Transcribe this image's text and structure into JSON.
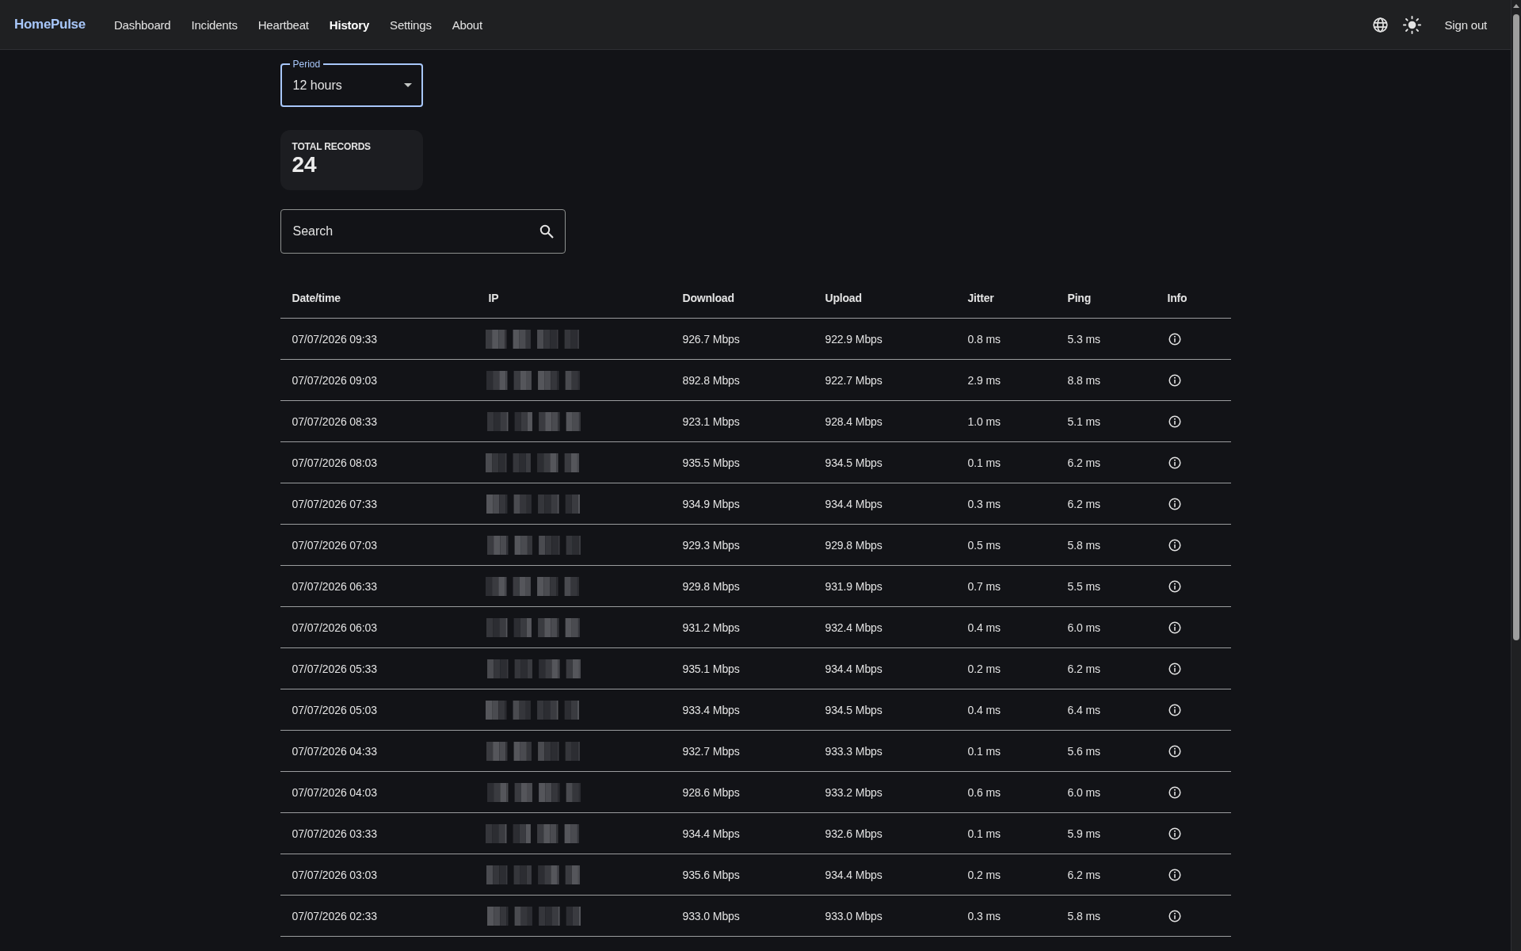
{
  "navbar": {
    "brand": "HomePulse",
    "items": [
      {
        "label": "Dashboard",
        "selected": false
      },
      {
        "label": "Incidents",
        "selected": false
      },
      {
        "label": "Heartbeat",
        "selected": false
      },
      {
        "label": "History",
        "selected": true
      },
      {
        "label": "Settings",
        "selected": false
      },
      {
        "label": "About",
        "selected": false
      }
    ],
    "sign_out": "Sign out"
  },
  "period_select": {
    "label": "Period",
    "value": "12 hours"
  },
  "total_records": {
    "label": "TOTAL RECORDS",
    "value": "24"
  },
  "search": {
    "placeholder": "Search"
  },
  "table": {
    "columns": [
      {
        "label": "Date/time",
        "kind": "datetime"
      },
      {
        "label": "IP",
        "kind": "ip"
      },
      {
        "label": "Download",
        "kind": "download"
      },
      {
        "label": "Upload",
        "kind": "upload"
      },
      {
        "label": "Jitter",
        "kind": "jitter"
      },
      {
        "label": "Ping",
        "kind": "ping"
      },
      {
        "label": "Info",
        "kind": "info"
      }
    ],
    "rows": [
      {
        "datetime": "07/07/2026 09:33",
        "ip_redacted": true,
        "download": "926.7 Mbps",
        "upload": "922.9 Mbps",
        "jitter": "0.8 ms",
        "ping": "5.3 ms"
      },
      {
        "datetime": "07/07/2026 09:03",
        "ip_redacted": true,
        "download": "892.8 Mbps",
        "upload": "922.7 Mbps",
        "jitter": "2.9 ms",
        "ping": "8.8 ms"
      },
      {
        "datetime": "07/07/2026 08:33",
        "ip_redacted": true,
        "download": "923.1 Mbps",
        "upload": "928.4 Mbps",
        "jitter": "1.0 ms",
        "ping": "5.1 ms"
      },
      {
        "datetime": "07/07/2026 08:03",
        "ip_redacted": true,
        "download": "935.5 Mbps",
        "upload": "934.5 Mbps",
        "jitter": "0.1 ms",
        "ping": "6.2 ms"
      },
      {
        "datetime": "07/07/2026 07:33",
        "ip_redacted": true,
        "download": "934.9 Mbps",
        "upload": "934.4 Mbps",
        "jitter": "0.3 ms",
        "ping": "6.2 ms"
      },
      {
        "datetime": "07/07/2026 07:03",
        "ip_redacted": true,
        "download": "929.3 Mbps",
        "upload": "929.8 Mbps",
        "jitter": "0.5 ms",
        "ping": "5.8 ms"
      },
      {
        "datetime": "07/07/2026 06:33",
        "ip_redacted": true,
        "download": "929.8 Mbps",
        "upload": "931.9 Mbps",
        "jitter": "0.7 ms",
        "ping": "5.5 ms"
      },
      {
        "datetime": "07/07/2026 06:03",
        "ip_redacted": true,
        "download": "931.2 Mbps",
        "upload": "932.4 Mbps",
        "jitter": "0.4 ms",
        "ping": "6.0 ms"
      },
      {
        "datetime": "07/07/2026 05:33",
        "ip_redacted": true,
        "download": "935.1 Mbps",
        "upload": "934.4 Mbps",
        "jitter": "0.2 ms",
        "ping": "6.2 ms"
      },
      {
        "datetime": "07/07/2026 05:03",
        "ip_redacted": true,
        "download": "933.4 Mbps",
        "upload": "934.5 Mbps",
        "jitter": "0.4 ms",
        "ping": "6.4 ms"
      },
      {
        "datetime": "07/07/2026 04:33",
        "ip_redacted": true,
        "download": "932.7 Mbps",
        "upload": "933.3 Mbps",
        "jitter": "0.1 ms",
        "ping": "5.6 ms"
      },
      {
        "datetime": "07/07/2026 04:03",
        "ip_redacted": true,
        "download": "928.6 Mbps",
        "upload": "933.2 Mbps",
        "jitter": "0.6 ms",
        "ping": "6.0 ms"
      },
      {
        "datetime": "07/07/2026 03:33",
        "ip_redacted": true,
        "download": "934.4 Mbps",
        "upload": "932.6 Mbps",
        "jitter": "0.1 ms",
        "ping": "5.9 ms"
      },
      {
        "datetime": "07/07/2026 03:03",
        "ip_redacted": true,
        "download": "935.6 Mbps",
        "upload": "934.4 Mbps",
        "jitter": "0.2 ms",
        "ping": "6.2 ms"
      },
      {
        "datetime": "07/07/2026 02:33",
        "ip_redacted": true,
        "download": "933.0 Mbps",
        "upload": "933.0 Mbps",
        "jitter": "0.3 ms",
        "ping": "5.8 ms"
      }
    ]
  }
}
